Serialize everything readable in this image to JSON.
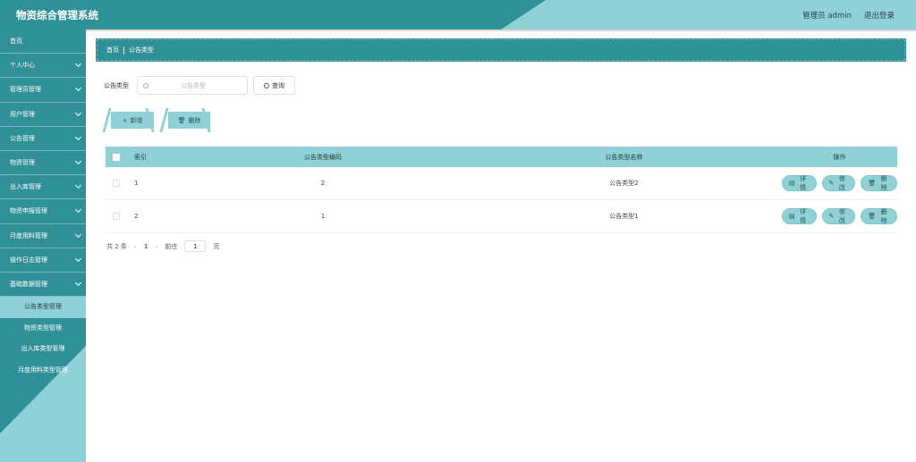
{
  "header": {
    "title": "物资综合管理系统",
    "user": "管理员 admin",
    "logout": "退出登录"
  },
  "sidebar": {
    "items": [
      {
        "label": "首页",
        "chevron": false
      },
      {
        "label": "个人中心",
        "chevron": true
      },
      {
        "label": "管理员管理",
        "chevron": true
      },
      {
        "label": "用户管理",
        "chevron": true
      },
      {
        "label": "公告管理",
        "chevron": true
      },
      {
        "label": "物资管理",
        "chevron": true
      },
      {
        "label": "出入库管理",
        "chevron": true
      },
      {
        "label": "物资申报管理",
        "chevron": true
      },
      {
        "label": "月度用料管理",
        "chevron": true
      },
      {
        "label": "操作日志管理",
        "chevron": true
      },
      {
        "label": "基础数据管理",
        "chevron": true
      }
    ],
    "submenu": [
      "公告类型管理",
      "物资类型管理",
      "出入库类型管理",
      "月度用料类型管理"
    ],
    "active_sub": "公告类型管理"
  },
  "breadcrumb": {
    "home": "首页",
    "current": "公告类型"
  },
  "search": {
    "label": "公告类型",
    "placeholder": "公告类型",
    "value": "",
    "button": "查询"
  },
  "actions": {
    "add": "新增",
    "delete": "删除"
  },
  "table": {
    "headers": {
      "index": "索引",
      "code": "公告类型编码",
      "name": "公告类型名称",
      "ops": "操作"
    },
    "rows": [
      {
        "index": "1",
        "code": "2",
        "name": "公告类型2"
      },
      {
        "index": "2",
        "code": "1",
        "name": "公告类型1"
      }
    ],
    "op_labels": {
      "detail": "详情",
      "edit": "修改",
      "delete": "删除"
    }
  },
  "pager": {
    "total": "共 2 条",
    "current": "1",
    "goto_prefix": "前往",
    "goto_value": "1",
    "goto_suffix": "页"
  },
  "colors": {
    "primary": "#2f9197",
    "accent": "#8fd1d6"
  }
}
